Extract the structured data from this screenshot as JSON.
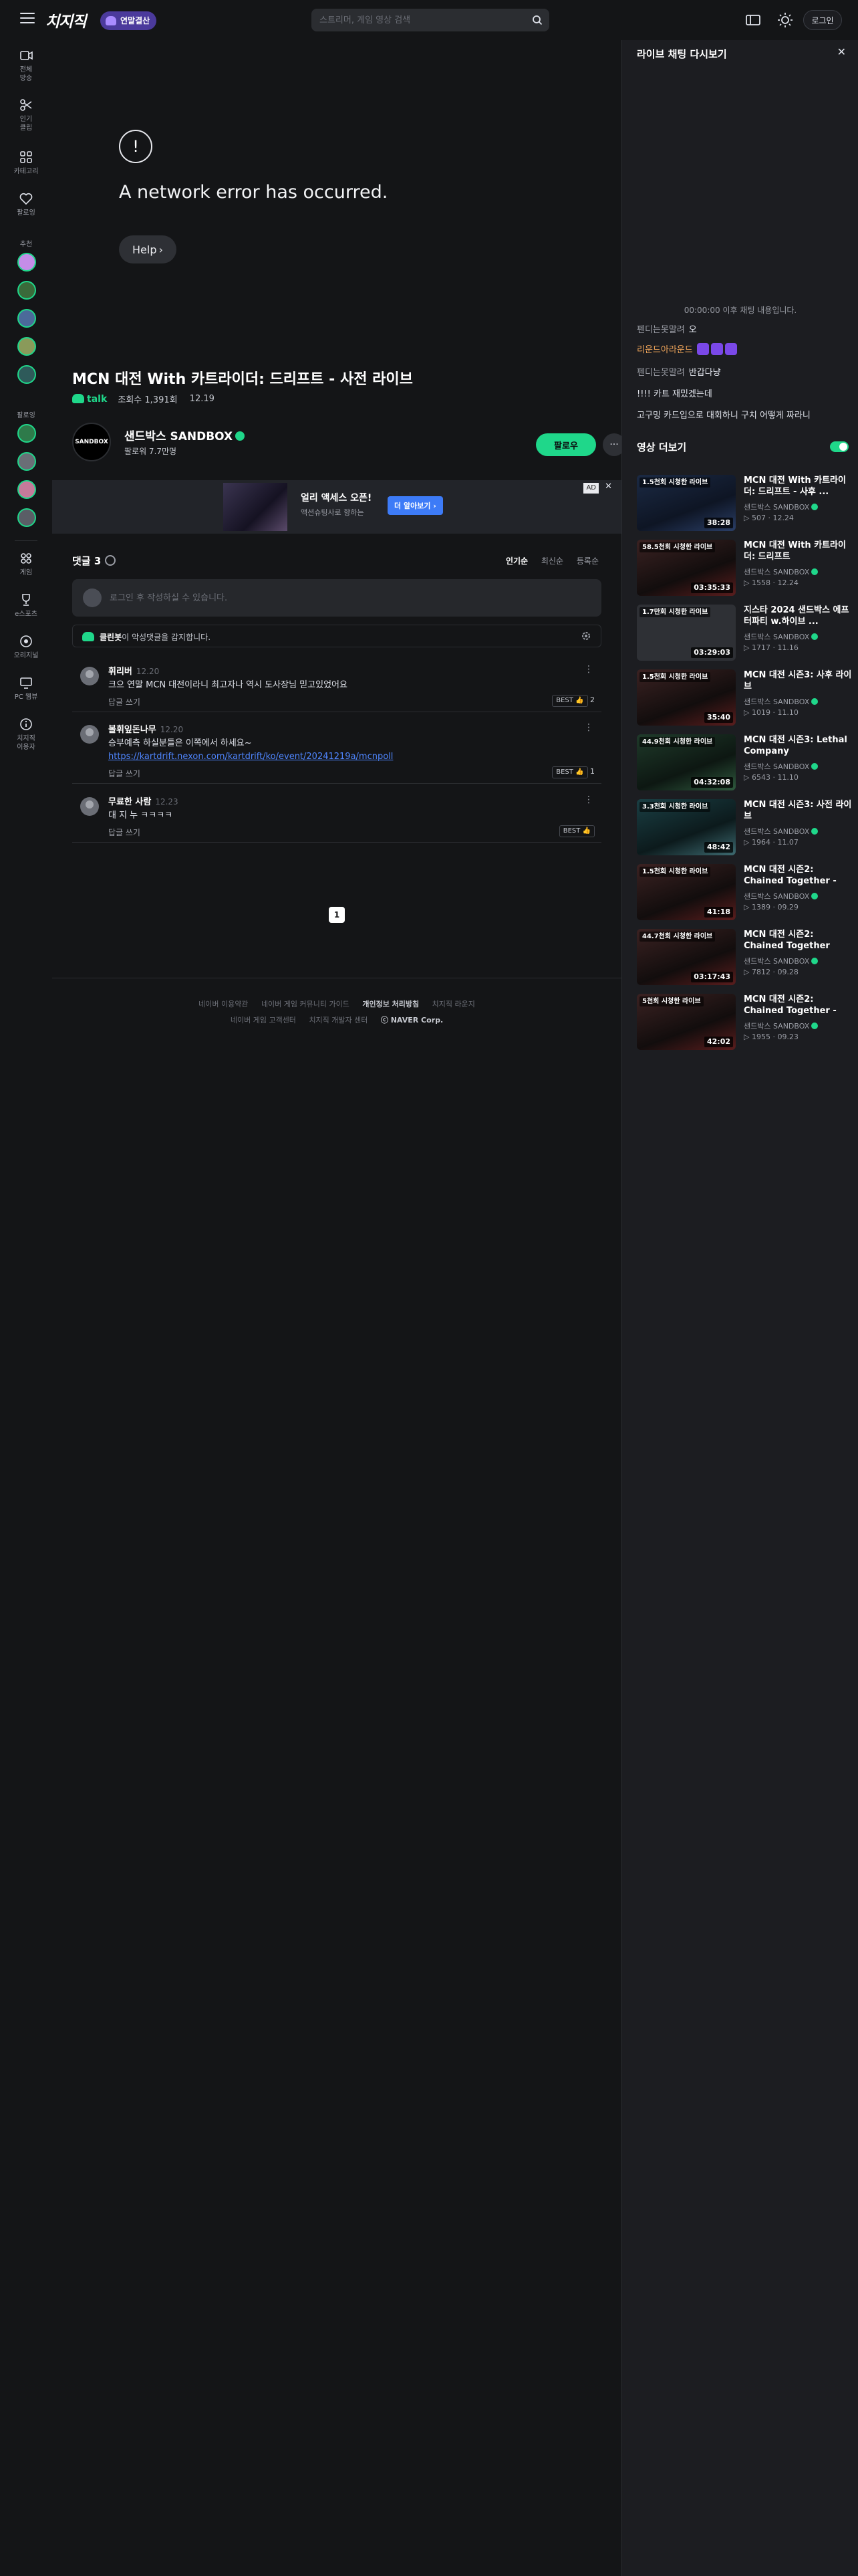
{
  "header": {
    "logo": "치지직",
    "promo": "연말결산",
    "search_placeholder": "스트리머, 게임 영상 검색",
    "login": "로그인"
  },
  "rail": {
    "items": [
      {
        "label": "전체\n방송",
        "icon": "video-icon"
      },
      {
        "label": "인기\n클립",
        "icon": "scissors-icon"
      },
      {
        "label": "카테고리",
        "icon": "grid-icon"
      },
      {
        "label": "팔로잉",
        "icon": "heart-icon"
      }
    ],
    "section_recommended": "추천",
    "section_following": "팔로잉",
    "bottom_items": [
      {
        "label": "게임",
        "icon": "game-icon"
      },
      {
        "label": "e스포츠",
        "icon": "trophy-icon"
      },
      {
        "label": "오리지널",
        "icon": "circle-icon"
      },
      {
        "label": "PC 웹뷰",
        "icon": "monitor-icon"
      },
      {
        "label": "치지직\n이용자",
        "icon": "info-icon"
      }
    ]
  },
  "player": {
    "error_icon": "!",
    "error_message": "A network error has occurred.",
    "help_label": "Help"
  },
  "video": {
    "title": "MCN 대전 With 카트라이더: 드리프트 - 사전 라이브",
    "talk": "talk",
    "views": "조회수 1,391회",
    "date": "12.19"
  },
  "channel": {
    "avatar_text": "SANDBOX",
    "name": "샌드박스 SANDBOX",
    "followers": "팔로워 7.7만명",
    "follow_label": "팔로우",
    "more_label": "···"
  },
  "ad": {
    "title": "얼리 액세스 오픈!",
    "subtitle": "액션슈팅사로 향하는",
    "cta": "더 알아보기 ›",
    "label": "AD",
    "close": "✕"
  },
  "comments": {
    "count_label": "댓글 3",
    "sort": [
      "인기순",
      "최신순",
      "등록순"
    ],
    "input_placeholder": "로그인 후 작성하실 수 있습니다.",
    "cleanbot_name": "클린봇",
    "cleanbot_text": "이 악성댓글을 감지합니다.",
    "reply_label": "답글 쓰기",
    "items": [
      {
        "nick": "휘리버",
        "time": "12.20",
        "body": "크으 연말 MCN 대전이라니 최고자나 역시 도사장님 믿고있었어요",
        "link": "",
        "likes": "2"
      },
      {
        "nick": "볼휘잎돈나무",
        "time": "12.20",
        "body": "승부예측 하실분들은 이쪽에서 하세요~",
        "link": "https://kartdrift.nexon.com/kartdrift/ko/event/20241219a/mcnpoll",
        "likes": "1"
      },
      {
        "nick": "무료한 사람",
        "time": "12.23",
        "body": "대 지 누 ㅋㅋㅋㅋ",
        "link": "",
        "likes": ""
      }
    ],
    "like_chip": "BEST 👍",
    "page": "1"
  },
  "footer": {
    "row1": [
      "네이버 이용약관",
      "네이버 게임 커뮤니티 가이드",
      "개인정보 처리방침",
      "치지직 라운지"
    ],
    "row2": [
      "네이버 게임 고객센터",
      "치지직 개발자 센터",
      "ⓒ NAVER Corp."
    ]
  },
  "chat": {
    "title": "라이브 채팅 다시보기",
    "close": "✕",
    "notice": "00:00:00 이후 채팅 내용입니다.",
    "lines": [
      {
        "nick": "펜디는못말려",
        "msg": "오",
        "color": "#9a9da5"
      },
      {
        "nick": "리운드아라운드",
        "msg": "",
        "color": "#f0a55a"
      },
      {
        "nick": "펜디는못말려",
        "msg": "반갑다냥",
        "color": "#9a9da5"
      },
      {
        "nick": "",
        "msg": "!!!! 카트 재밌겠는데",
        "color": "#dfe2ea"
      },
      {
        "nick": "",
        "msg": "고구밍  카드입으로 대회하니 구치 어떻게 짜라니",
        "color": "#dfe2ea"
      }
    ]
  },
  "more_videos": {
    "title": "영상 더보기",
    "items": [
      {
        "views": "1.5천회 시청한 라이브",
        "dur": "38:28",
        "title": "MCN 대전 With 카트라이더: 드리프트 - 사후 ...",
        "channel": "샌드박스 SANDBOX",
        "stat": "▷ 507 · 12.24",
        "theme": "blue"
      },
      {
        "views": "58.5천회 시청한 라이브",
        "dur": "03:35:33",
        "title": "MCN 대전 With 카트라이더: 드리프트",
        "channel": "샌드박스 SANDBOX",
        "stat": "▷ 1558 · 12.24",
        "theme": "red"
      },
      {
        "views": "1.7만회 시청한 라이브",
        "dur": "03:29:03",
        "title": "지스타 2024 샌드박스 에프터파티 w.하이브 ...",
        "channel": "샌드박스 SANDBOX",
        "stat": "▷ 1717 · 11.16",
        "theme": "gray"
      },
      {
        "views": "1.5천회 시청한 라이브",
        "dur": "35:40",
        "title": "MCN 대전 시즌3: 사후 라이브",
        "channel": "샌드박스 SANDBOX",
        "stat": "▷ 1019 · 11.10",
        "theme": "red"
      },
      {
        "views": "44.9천회 시청한 라이브",
        "dur": "04:32:08",
        "title": "MCN 대전 시즌3: Lethal Company",
        "channel": "샌드박스 SANDBOX",
        "stat": "▷ 6543 · 11.10",
        "theme": "green"
      },
      {
        "views": "3.3천회 시청한 라이브",
        "dur": "48:42",
        "title": "MCN 대전 시즌3: 사전 라이브",
        "channel": "샌드박스 SANDBOX",
        "stat": "▷ 1964 · 11.07",
        "theme": "teal"
      },
      {
        "views": "1.5천회 시청한 라이브",
        "dur": "41:18",
        "title": "MCN 대전 시즌2: Chained Together - 사...",
        "channel": "샌드박스 SANDBOX",
        "stat": "▷ 1389 · 09.29",
        "theme": "red"
      },
      {
        "views": "44.7천회 시청한 라이브",
        "dur": "03:17:43",
        "title": "MCN 대전 시즌2: Chained Together",
        "channel": "샌드박스 SANDBOX",
        "stat": "▷ 7812 · 09.28",
        "theme": "red"
      },
      {
        "views": "5천회 시청한 라이브",
        "dur": "42:02",
        "title": "MCN 대전 시즌2: Chained Together - 사...",
        "channel": "샌드박스 SANDBOX",
        "stat": "▷ 1955 · 09.23",
        "theme": "red"
      }
    ]
  },
  "colors": {
    "accent": "#1fd78a",
    "background": "#141517",
    "panel": "#1c1d21",
    "link": "#4f86ff"
  }
}
